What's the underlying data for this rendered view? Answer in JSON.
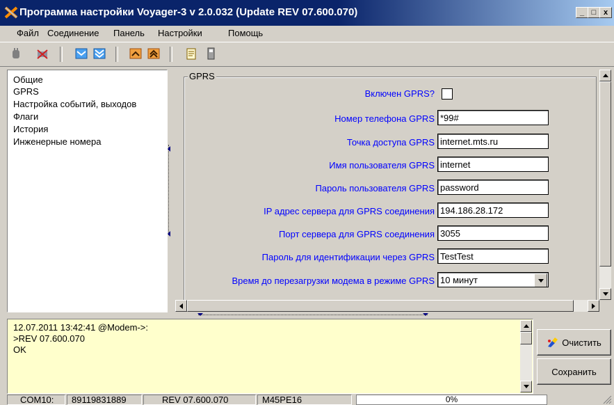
{
  "window": {
    "title": "Программа настройки Voyager-3 v 2.0.032 (Update REV 07.600.070)",
    "controls": [
      "_",
      "□",
      "x"
    ]
  },
  "menu": [
    "Файл",
    "Соединение",
    "Панель",
    "Настройки",
    "Помощь"
  ],
  "toolbar": [
    "connect-icon",
    "disconnect-icon",
    "mail-icon",
    "mail-all-icon",
    "arrow-up-icon",
    "arrow-up-double-icon",
    "notepad-icon",
    "save-device-icon"
  ],
  "tree": {
    "items": [
      "Общие",
      "GPRS",
      "Настройка событий, выходов",
      "Флаги",
      "История",
      "Инженерные номера"
    ]
  },
  "gprs": {
    "group_title": "GPRS",
    "enabled_label": "Включен GPRS?",
    "fields": [
      {
        "label": "Номер телефона GPRS",
        "value": "*99#"
      },
      {
        "label": "Точка доступа GPRS",
        "value": "internet.mts.ru"
      },
      {
        "label": "Имя пользователя GPRS",
        "value": "internet"
      },
      {
        "label": "Пароль пользователя GPRS",
        "value": "password"
      },
      {
        "label": "IP адрес сервера для GPRS соединения",
        "value": "194.186.28.172"
      },
      {
        "label": "Порт сервера для GPRS соединения",
        "value": "3055"
      },
      {
        "label": "Пароль для идентификации через GPRS",
        "value": "TestTest"
      }
    ],
    "restart_label": "Время до перезагрузки модема в режиме GPRS",
    "restart_value": "10 минут"
  },
  "log": {
    "lines": [
      "12.07.2011 13:42:41 @Modem->:",
      ">REV 07.600.070",
      "OK"
    ]
  },
  "buttons": {
    "clear": "Очистить",
    "save": "Сохранить"
  },
  "status": {
    "port": "COM10:",
    "phone": "89119831889",
    "rev": "REV 07.600.070",
    "model": "M45PE16",
    "progress": "0%"
  },
  "colors": {
    "title_bar": "#0a246a",
    "label_blue": "#0000ff",
    "log_bg": "#ffffcc"
  }
}
